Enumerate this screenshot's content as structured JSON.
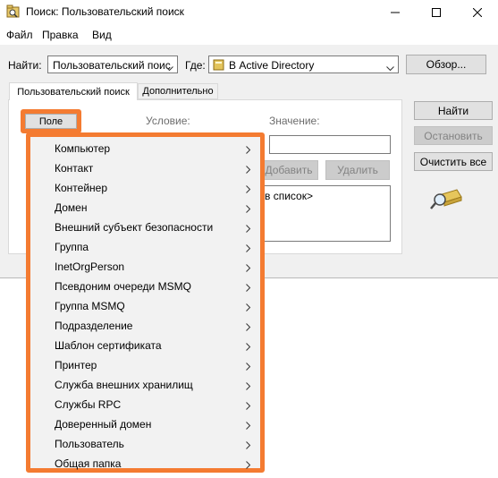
{
  "window": {
    "title": "Поиск: Пользовательский поиск"
  },
  "menubar": [
    "Файл",
    "Правка",
    "Вид"
  ],
  "toolbar": {
    "find_label": "Найти:",
    "find_value": "Пользовательский поис",
    "where_label": "Где:",
    "where_value": "В Active Directory",
    "browse_button": "Обзор..."
  },
  "tabs": [
    "Пользовательский поиск",
    "Дополнительно"
  ],
  "panel": {
    "field_button": "Поле",
    "condition_label": "Условие:",
    "value_label": "Значение:",
    "add_button": "Добавить",
    "remove_button": "Удалить",
    "list_hint": "в список>"
  },
  "right_buttons": {
    "find_now": "Найти",
    "stop": "Остановить",
    "clear_all": "Очистить все"
  },
  "field_menu": {
    "items": [
      "Компьютер",
      "Контакт",
      "Контейнер",
      "Домен",
      "Внешний субъект безопасности",
      "Группа",
      "InetOrgPerson",
      "Псевдоним очереди MSMQ",
      "Группа MSMQ",
      "Подразделение",
      "Шаблон сертификата",
      "Принтер",
      "Служба внешних хранилищ",
      "Службы RPC",
      "Доверенный домен",
      "Пользователь",
      "Общая папка"
    ]
  },
  "colors": {
    "highlight": "#f47b31",
    "window_bg": "#f0f0f0",
    "disabled_text": "#838383"
  }
}
